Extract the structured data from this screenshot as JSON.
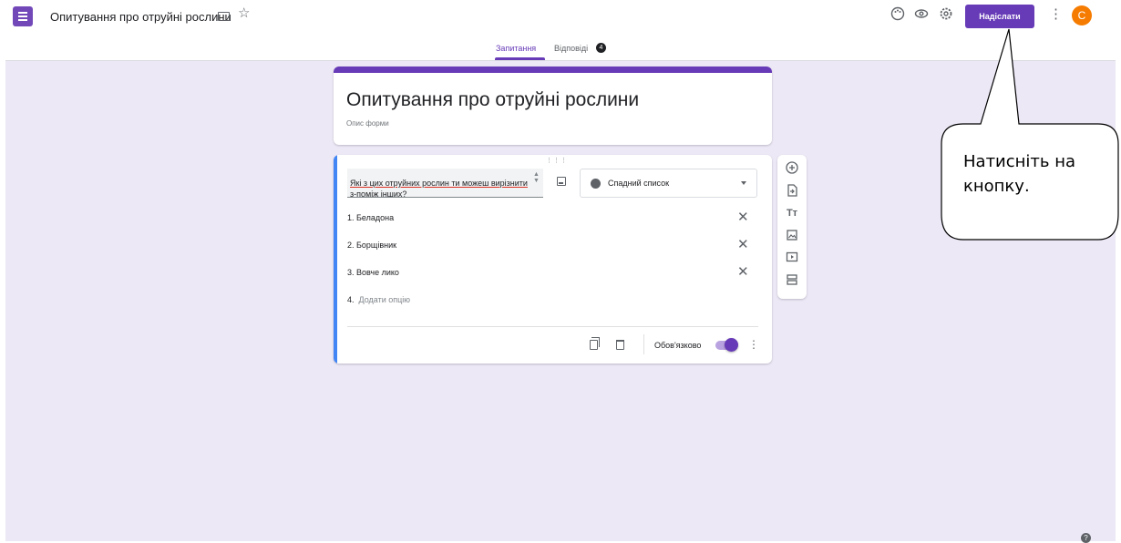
{
  "header": {
    "doc_title": "Опитування про отруйні рослини",
    "send_label": "Надіслати",
    "avatar_letter": "С"
  },
  "tabs": {
    "questions_label": "Запитання",
    "responses_label": "Відповіді",
    "responses_count": "4"
  },
  "form": {
    "title": "Опитування про отруйні рослини",
    "description_placeholder": "Опис форми"
  },
  "question": {
    "text": "Які з цих отруйних рослин ти можеш вирізнити з-поміж інших?",
    "type_label": "Спадний список",
    "options": [
      {
        "label": "1.  Беладона"
      },
      {
        "label": "2.  Борщівник"
      },
      {
        "label": "3.  Вовче лико"
      }
    ],
    "add_option_number": "4.",
    "add_option_label": "Додати опцію",
    "required_label": "Обов'язково",
    "required": true
  },
  "callout": {
    "line1": "Натисніть на",
    "line2": "кнопку."
  },
  "colors": {
    "accent": "#673ab7",
    "canvas": "#ede8f6",
    "active_question": "#4285f4",
    "avatar": "#f57c00"
  }
}
